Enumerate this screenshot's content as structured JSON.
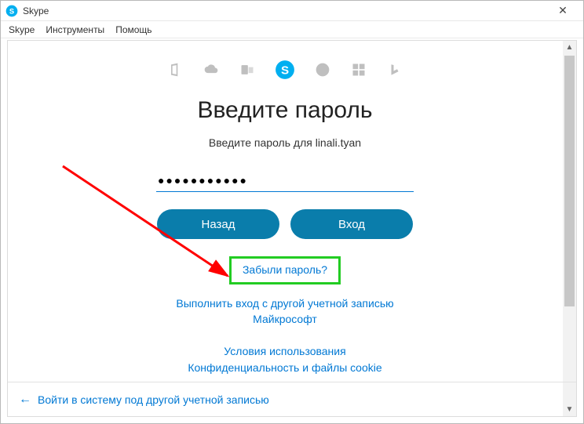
{
  "window": {
    "title": "Skype"
  },
  "menu": {
    "skype": "Skype",
    "tools": "Инструменты",
    "help": "Помощь"
  },
  "iconRow": {
    "office": "office-icon",
    "onedrive": "onedrive-icon",
    "outlook": "outlook-icon",
    "skype": "skype-icon",
    "xbox": "xbox-icon",
    "windows": "windows-icon",
    "bing": "bing-icon"
  },
  "main": {
    "heading": "Введите пароль",
    "sub": "Введите пароль для linali.tyan",
    "passwordMask": "●●●●●●●●●●●",
    "backBtn": "Назад",
    "loginBtn": "Вход",
    "forgot": "Забыли пароль?",
    "otherAccount1": "Выполнить вход с другой учетной записью",
    "otherAccount2": "Майкрософт"
  },
  "legal": {
    "terms": "Условия использования",
    "privacy": "Конфиденциальность и файлы cookie"
  },
  "footer": {
    "signInOther": "Войти в систему под другой учетной записью"
  }
}
